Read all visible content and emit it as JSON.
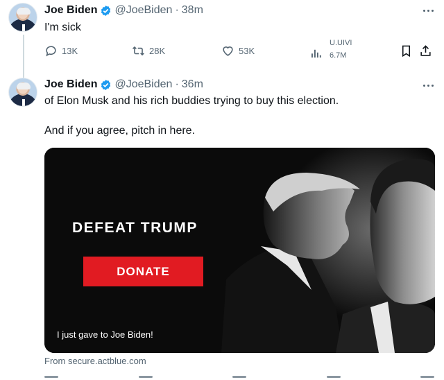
{
  "colors": {
    "accent": "#1d9bf0",
    "text": "#0f1419",
    "muted": "#536471",
    "donate": "#e11b22"
  },
  "tweets": [
    {
      "author": "Joe Biden",
      "handle": "@JoeBiden",
      "separator": "·",
      "time": "38m",
      "text": "I'm sick",
      "actions": {
        "replies": "13K",
        "retweets": "28K",
        "likes": "53K",
        "views_label": "U.UIVI",
        "views": "6.7M"
      }
    },
    {
      "author": "Joe Biden",
      "handle": "@JoeBiden",
      "separator": "·",
      "time": "36m",
      "text_line1": "of Elon Musk and his rich buddies trying to buy this election.",
      "text_line2": "And if you agree, pitch in here.",
      "card": {
        "headline": "DEFEAT TRUMP",
        "button": "DONATE",
        "caption": "I just gave to Joe Biden!"
      },
      "source": "From secure.actblue.com"
    }
  ],
  "icons": [
    "verified-badge-icon",
    "more-icon",
    "reply-icon",
    "retweet-icon",
    "like-icon",
    "views-icon",
    "bookmark-icon",
    "share-icon"
  ]
}
